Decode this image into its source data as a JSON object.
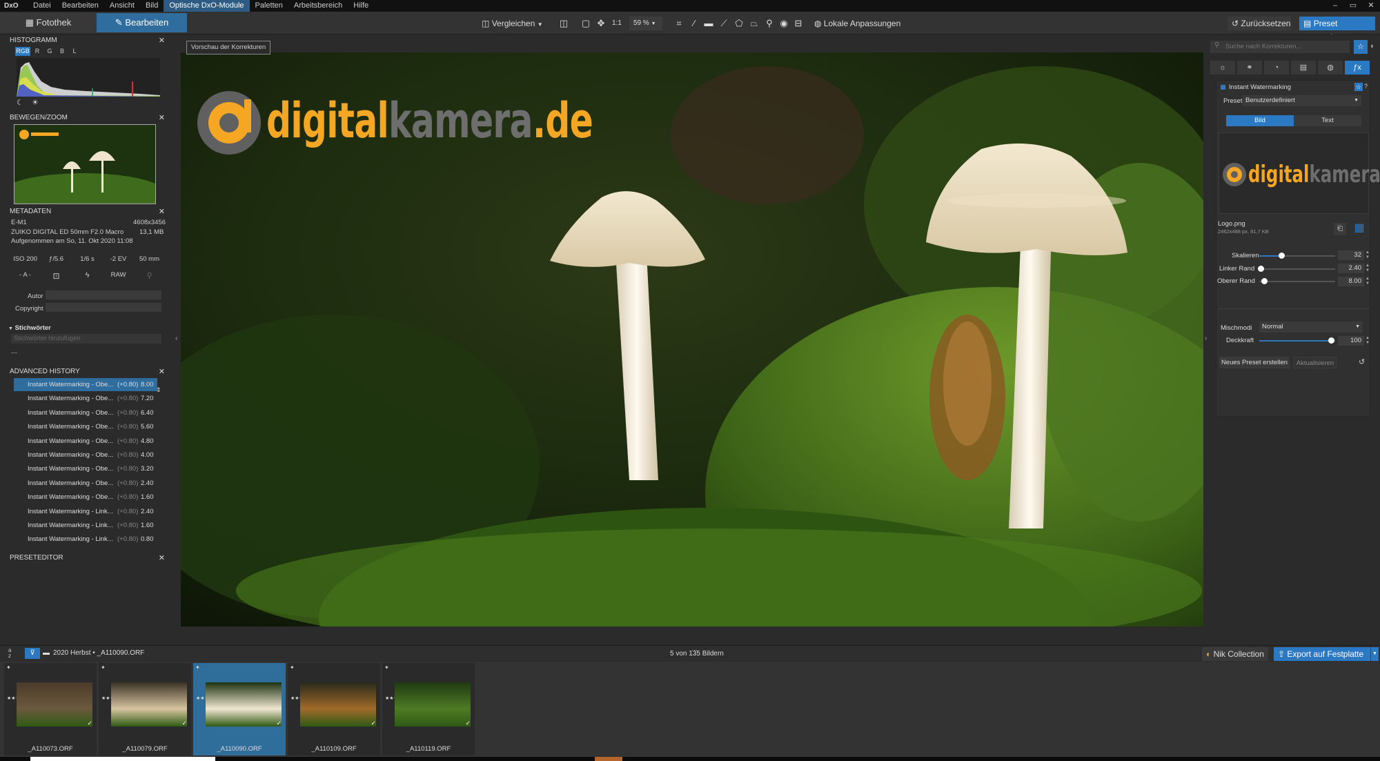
{
  "menubar": {
    "logo": "DxO",
    "items": [
      "Datei",
      "Bearbeiten",
      "Ansicht",
      "Bild",
      "Optische DxO-Module",
      "Paletten",
      "Arbeitsbereich",
      "Hilfe"
    ],
    "active_index": 4
  },
  "toolbar": {
    "tab_library": "Fotothek",
    "tab_edit": "Bearbeiten",
    "compare": "Vergleichen",
    "zoom_1to1": "1:1",
    "zoom_value": "59 %",
    "local_adjust": "Lokale Anpassungen",
    "reset": "Zurücksetzen",
    "apply_preset": "Preset anwenden"
  },
  "left": {
    "histogram_title": "HISTOGRAMM",
    "hist_tabs": [
      "RGB",
      "R",
      "G",
      "B",
      "L"
    ],
    "navigator_title": "BEWEGEN/ZOOM",
    "metadata_title": "METADATEN",
    "camera": "E-M1",
    "dimensions": "4608x3456",
    "lens": "ZUIKO DIGITAL ED 50mm F2.0 Macro",
    "filesize": "13,1 MB",
    "taken": "Aufgenommen am So, 11. Okt 2020 11:08",
    "exif": [
      "ISO 200",
      "ƒ/5.6",
      "1/6 s",
      "-2 EV",
      "50 mm"
    ],
    "exif2": [
      "- A -",
      "RAW"
    ],
    "author_label": "Autor",
    "copyright_label": "Copyright",
    "keywords_title": "Stichwörter",
    "keywords_placeholder": "Stichwörter hinzufügen",
    "keywords_dash": "---",
    "history_title": "ADVANCED HISTORY",
    "history": [
      {
        "label": "Instant Watermarking - Obe...",
        "delta": "(+0.80)",
        "value": "8.00"
      },
      {
        "label": "Instant Watermarking - Obe...",
        "delta": "(+0.80)",
        "value": "7.20"
      },
      {
        "label": "Instant Watermarking - Obe...",
        "delta": "(+0.80)",
        "value": "6.40"
      },
      {
        "label": "Instant Watermarking - Obe...",
        "delta": "(+0.80)",
        "value": "5.60"
      },
      {
        "label": "Instant Watermarking - Obe...",
        "delta": "(+0.80)",
        "value": "4.80"
      },
      {
        "label": "Instant Watermarking - Obe...",
        "delta": "(+0.80)",
        "value": "4.00"
      },
      {
        "label": "Instant Watermarking - Obe...",
        "delta": "(+0.80)",
        "value": "3.20"
      },
      {
        "label": "Instant Watermarking - Obe...",
        "delta": "(+0.80)",
        "value": "2.40"
      },
      {
        "label": "Instant Watermarking - Obe...",
        "delta": "(+0.80)",
        "value": "1.60"
      },
      {
        "label": "Instant Watermarking - Link...",
        "delta": "(+0.80)",
        "value": "2.40"
      },
      {
        "label": "Instant Watermarking - Link...",
        "delta": "(+0.80)",
        "value": "1.60"
      },
      {
        "label": "Instant Watermarking - Link...",
        "delta": "(+0.80)",
        "value": "0.80"
      }
    ],
    "preset_editor_title": "PRESETEDITOR"
  },
  "viewer": {
    "tooltip": "Vorschau der Korrekturen",
    "watermark_a": "digital",
    "watermark_b": "kamera",
    "watermark_c": ".de"
  },
  "right": {
    "search_placeholder": "Suche nach Korrekturen...",
    "module_title": "Instant Watermarking",
    "preset_label": "Preset",
    "preset_value": "Benutzerdefiniert",
    "tab_image": "Bild",
    "tab_text": "Text",
    "logo_file": "Logo.png",
    "logo_info": "2462x488 px, 81,7 KB",
    "scale_label": "Skalieren",
    "scale_value": "32",
    "left_margin_label": "Linker Rand",
    "left_margin_value": "2.40",
    "top_margin_label": "Oberer Rand",
    "top_margin_value": "8.00",
    "blend_label": "Mischmodi",
    "blend_value": "Normal",
    "opacity_label": "Deckkraft",
    "opacity_value": "100",
    "new_preset": "Neues Preset erstellen",
    "update": "Aktualisieren"
  },
  "bottombar": {
    "path": "2020 Herbst • _A110090.ORF",
    "count": "5 von 135 Bildern",
    "nik": "Nik Collection",
    "export": "Export auf Festplatte"
  },
  "filmstrip": [
    {
      "name": "_A110073.ORF",
      "selected": false
    },
    {
      "name": "_A110079.ORF",
      "selected": false
    },
    {
      "name": "_A110090.ORF",
      "selected": true
    },
    {
      "name": "_A110109.ORF",
      "selected": false
    },
    {
      "name": "_A110119.ORF",
      "selected": false
    }
  ],
  "colors": {
    "accent": "#2b79c2",
    "brand_orange": "#f5a623",
    "watermark_gray": "#6e6e6e"
  }
}
